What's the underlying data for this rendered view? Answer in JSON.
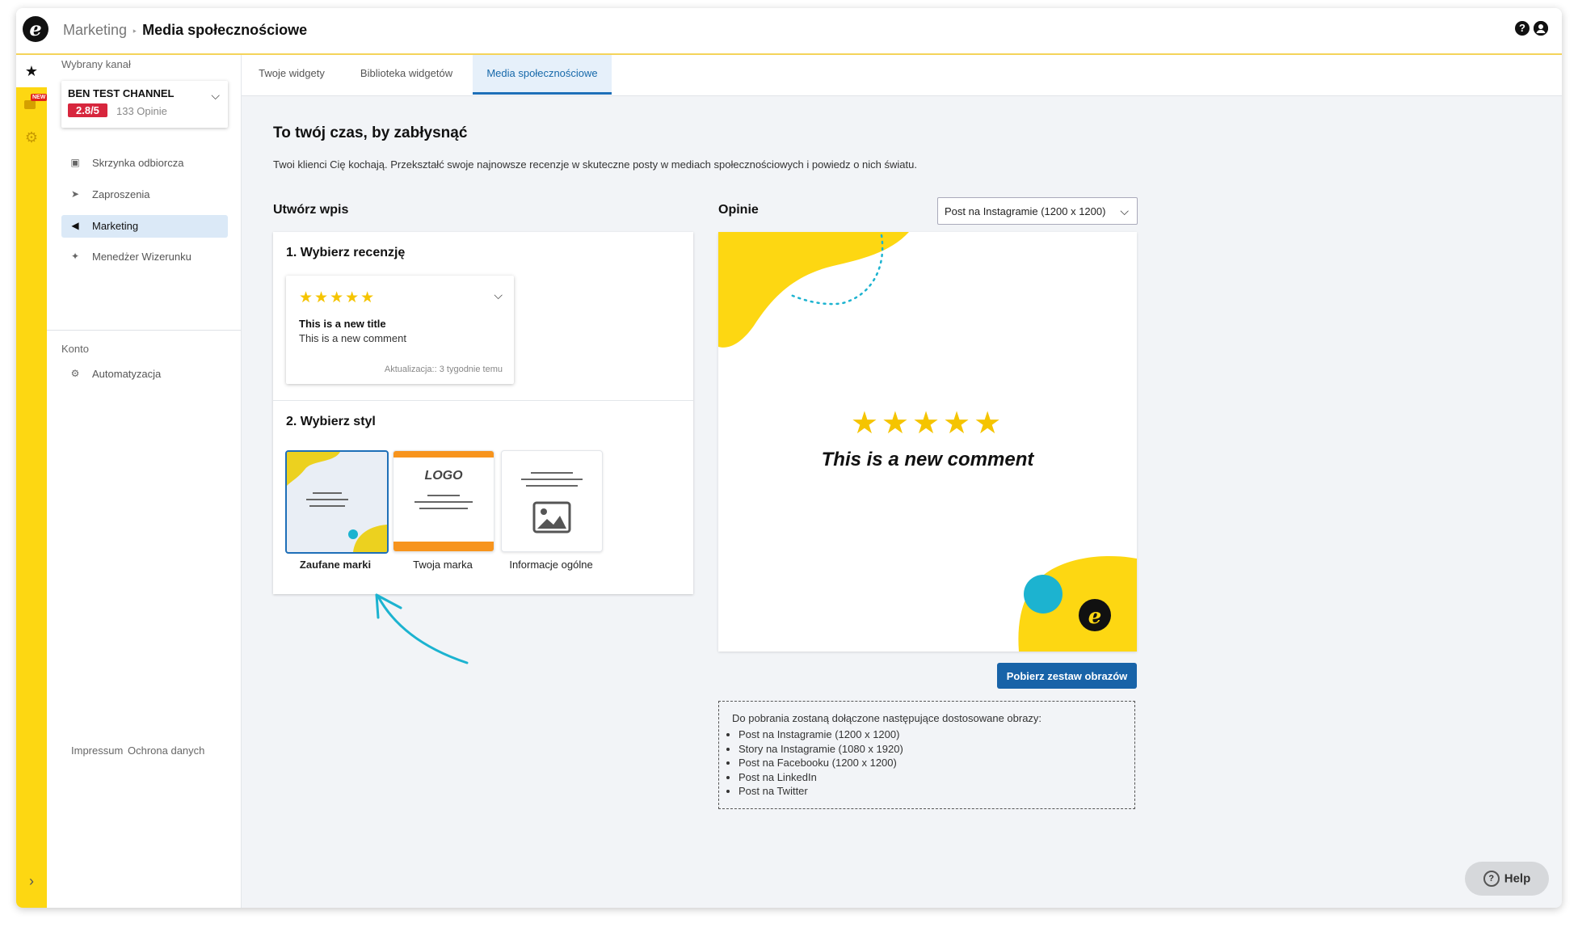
{
  "header": {
    "breadcrumb_parent": "Marketing",
    "breadcrumb_sep": "‣",
    "breadcrumb_current": "Media społecznościowe",
    "help_icon": "?",
    "account_icon": "person-icon"
  },
  "rail": {
    "badge_new": "NEW"
  },
  "sidebar": {
    "channel_label": "Wybrany kanał",
    "channel_name": "BEN TEST CHANNEL",
    "channel_rating": "2.8/5",
    "channel_reviews": "133 Opinie",
    "items": [
      {
        "label": "Skrzynka odbiorcza",
        "icon": "inbox-icon"
      },
      {
        "label": "Zaproszenia",
        "icon": "send-icon"
      },
      {
        "label": "Marketing",
        "icon": "megaphone-icon"
      },
      {
        "label": "Menedżer Wizerunku",
        "icon": "sparkle-icon"
      }
    ],
    "account_label": "Konto",
    "account_items": [
      {
        "label": "Automatyzacja",
        "icon": "gears-icon"
      }
    ],
    "footer": {
      "impressum": "Impressum",
      "privacy": "Ochrona danych"
    }
  },
  "tabs": [
    "Twoje widgety",
    "Biblioteka widgetów",
    "Media społecznościowe"
  ],
  "main": {
    "title": "To twój czas, by zabłysnąć",
    "description": "Twoi klienci Cię kochają. Przekształć swoje najnowsze recenzje w skuteczne posty w mediach społecznościowych i powiedz o nich światu.",
    "create_heading": "Utwórz wpis",
    "step1": "1. Wybierz recenzję",
    "review": {
      "stars": "★★★★★",
      "title": "This is a new title",
      "comment": "This is a new comment",
      "updated": "Aktualizacja:: 3 tygodnie temu"
    },
    "step2": "2. Wybierz styl",
    "styles": [
      {
        "label": "Zaufane marki",
        "selected": true
      },
      {
        "label": "Twoja marka",
        "logo_text": "LOGO"
      },
      {
        "label": "Informacje ogólne"
      }
    ],
    "preview_heading": "Opinie",
    "format_select": "Post na Instagramie (1200 x 1200)",
    "preview": {
      "stars": "★★★★★",
      "comment": "This is a new comment"
    },
    "download_button": "Pobierz zestaw obrazów",
    "info": {
      "intro": "Do pobrania zostaną dołączone następujące dostosowane obrazy:",
      "items": [
        "Post na Instagramie (1200 x 1200)",
        "Story na Instagramie (1080 x 1920)",
        "Post na Facebooku (1200 x 1200)",
        "Post na LinkedIn",
        "Post na Twitter"
      ]
    }
  },
  "help_button": "Help",
  "colors": {
    "brand_yellow": "#fdd712",
    "accent_blue": "#1e6fb8",
    "rating_red": "#d7263d",
    "cyan": "#1cb3d0"
  }
}
